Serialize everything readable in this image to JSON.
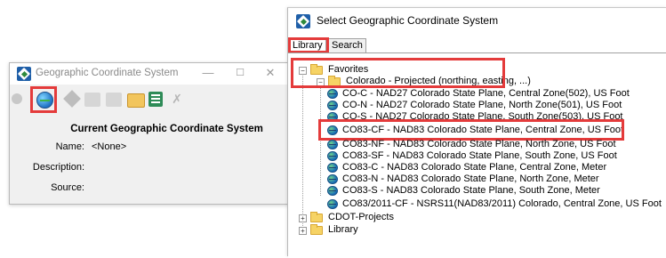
{
  "left_window": {
    "title": "Geographic Coordinate System",
    "minimize_glyph": "—",
    "maximize_glyph": "☐",
    "close_glyph": "✕",
    "toolbar": {
      "icons": [
        "info-icon",
        "globe-select-icon",
        "pin-icon",
        "stamp-icon",
        "stamp-icon",
        "folder-icon",
        "list-icon",
        "delete-icon"
      ]
    },
    "current_title": "Current Geographic Coordinate System",
    "fields": [
      {
        "label": "Name:",
        "value": "<None>"
      },
      {
        "label": "Description:",
        "value": ""
      },
      {
        "label": "Source:",
        "value": ""
      }
    ]
  },
  "right_window": {
    "title": "Select Geographic Coordinate System",
    "tabs": [
      "Library",
      "Search"
    ],
    "active_tab": "Library",
    "tree": {
      "favorites": "Favorites",
      "colorado_folder": "Colorado - Projected (northing, easting, ...)",
      "items": [
        "CO-C - NAD27 Colorado State Plane, Central Zone(502), US Foot",
        "CO-N - NAD27 Colorado State Plane, North Zone(501), US Foot",
        "CO-S - NAD27 Colorado State Plane, South Zone(503), US Foot",
        "CO83-CF - NAD83 Colorado State Plane, Central Zone, US Foot",
        "CO83-NF - NAD83 Colorado State Plane, North Zone, US Foot",
        "CO83-SF - NAD83 Colorado State Plane, South Zone, US Foot",
        "CO83-C - NAD83 Colorado State Plane, Central Zone, Meter",
        "CO83-N - NAD83 Colorado State Plane, North Zone, Meter",
        "CO83-S - NAD83 Colorado State Plane, South Zone, Meter"
      ],
      "favorite_item": "CO83/2011-CF - NSRS11(NAD83/2011) Colorado, Central Zone, US Foot",
      "cdot_folder": "CDOT-Projects",
      "library_folder": "Library"
    }
  },
  "colors": {
    "highlight": "#e43b3b",
    "folder": "#f6d365",
    "globe": "#1a6fb8"
  }
}
